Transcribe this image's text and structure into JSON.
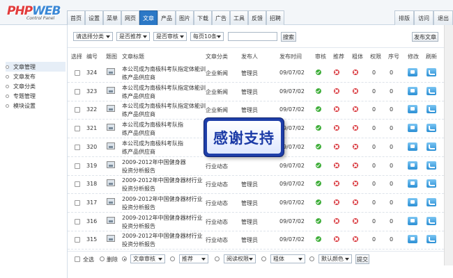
{
  "logo": {
    "main": "PHPWEB",
    "sub": "Control Panel"
  },
  "nav": {
    "tabs": [
      "首页",
      "设置",
      "菜单",
      "网页",
      "文章",
      "产品",
      "图片",
      "下载",
      "广告",
      "工具",
      "反馈",
      "招聘"
    ],
    "active": "文章",
    "right": [
      "排版",
      "访问",
      "退出"
    ]
  },
  "sidebar": {
    "items": [
      "文章管理",
      "文章发布",
      "文章分类",
      "专题管理",
      "模块设置"
    ],
    "active": "文章管理"
  },
  "filters": {
    "category": "请选择分类",
    "recommend": "是否推荐",
    "audit": "是否审核",
    "per_page": "每页10条",
    "search_btn": "搜索",
    "publish_btn": "发布文章"
  },
  "table": {
    "headers": {
      "select": "选择",
      "id": "编号",
      "pic": "题图",
      "title": "文章标题",
      "category": "文章分类",
      "author": "发布人",
      "time": "发布时间",
      "audit": "审核",
      "recommend": "推荐",
      "bold": "粗体",
      "perm": "权限",
      "order": "序号",
      "edit": "修改",
      "refresh": "刷新"
    },
    "rows": [
      {
        "id": "324",
        "title_line1": "本公司成为南极科考队指定体能训",
        "title_line2": "练产品供应商",
        "category": "企业新闻",
        "author": "管理员",
        "time": "09/07/02",
        "perm": "0",
        "order": "0"
      },
      {
        "id": "323",
        "title_line1": "本公司成为南极科考队指定体能训",
        "title_line2": "练产品供应商",
        "category": "企业新闻",
        "author": "管理员",
        "time": "09/07/02",
        "perm": "0",
        "order": "0"
      },
      {
        "id": "322",
        "title_line1": "本公司成为南极科考队指定体能训",
        "title_line2": "练产品供应商",
        "category": "企业新闻",
        "author": "管理员",
        "time": "09/07/02",
        "perm": "0",
        "order": "0"
      },
      {
        "id": "321",
        "title_line1": "本公司成为南极科考队指",
        "title_line2": "练产品供应商",
        "category": "",
        "author": "",
        "time": "09/07/02",
        "perm": "0",
        "order": "0"
      },
      {
        "id": "320",
        "title_line1": "本公司成为南极科考队指",
        "title_line2": "练产品供应商",
        "category": "",
        "author": "",
        "time": "09/07/02",
        "perm": "0",
        "order": "0"
      },
      {
        "id": "319",
        "title_line1": "2009-2012年中国健身器",
        "title_line2": "投资分析报告",
        "category": "行业动态",
        "author": "",
        "time": "09/07/02",
        "perm": "0",
        "order": "0"
      },
      {
        "id": "318",
        "title_line1": "2009-2012年中国健身器材行业",
        "title_line2": "投资分析报告",
        "category": "行业动态",
        "author": "管理员",
        "time": "09/07/02",
        "perm": "0",
        "order": "0"
      },
      {
        "id": "317",
        "title_line1": "2009-2012年中国健身器材行业",
        "title_line2": "投资分析报告",
        "category": "行业动态",
        "author": "管理员",
        "time": "09/07/02",
        "perm": "0",
        "order": "0"
      },
      {
        "id": "316",
        "title_line1": "2009-2012年中国健身器材行业",
        "title_line2": "投资分析报告",
        "category": "行业动态",
        "author": "管理员",
        "time": "09/07/02",
        "perm": "0",
        "order": "0"
      },
      {
        "id": "315",
        "title_line1": "2009-2012年中国健身器材行业",
        "title_line2": "投资分析报告",
        "category": "行业动态",
        "author": "管理员",
        "time": "09/07/02",
        "perm": "0",
        "order": "0"
      }
    ]
  },
  "bottom": {
    "select_all": "全选",
    "delete": "删除",
    "audit": "文章审核",
    "recommend": "推荐",
    "read_perm": "阅读权限",
    "bold": "粗体",
    "color": "默认颜色",
    "submit": "提交"
  },
  "overlay": {
    "text": "感谢支持"
  }
}
